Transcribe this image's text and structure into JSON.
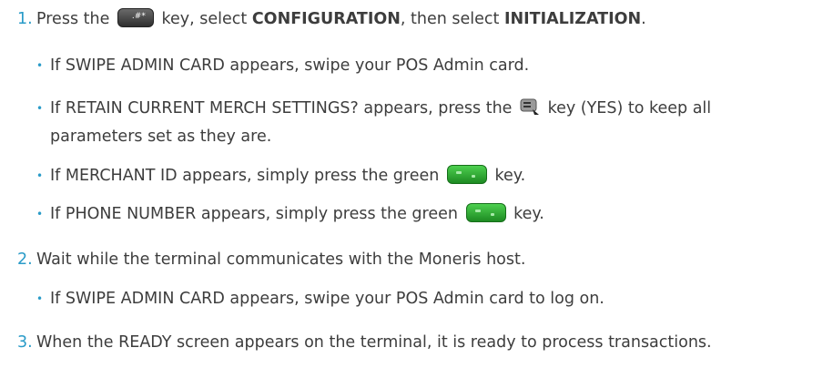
{
  "steps": [
    {
      "number": "1.",
      "parts": {
        "a": "Press the",
        "b": "key, select",
        "c": "CONFIGURATION",
        "d": ", then select",
        "e": "INITIALIZATION",
        "f": "."
      },
      "bullets": [
        {
          "text": "If SWIPE ADMIN CARD appears, swipe your POS Admin card."
        },
        {
          "a": "If RETAIN CURRENT MERCH SETTINGS? appears, press the",
          "b": "key (YES) to keep all",
          "c": "parameters set as they are."
        },
        {
          "a": "If MERCHANT ID appears, simply press the green",
          "b": "key."
        },
        {
          "a": "If PHONE NUMBER appears, simply press the green",
          "b": "key."
        }
      ]
    },
    {
      "number": "2.",
      "text": "Wait while the terminal communicates with the Moneris host.",
      "bullets": [
        {
          "text": "If SWIPE ADMIN CARD appears, swipe your POS Admin card to log on."
        }
      ]
    },
    {
      "number": "3.",
      "text": "When the READY screen appears on the terminal, it is ready to process transactions."
    }
  ],
  "bullet_symbol": "•",
  "icons": {
    "hash_key_label": ".#*",
    "hash_key": "hash-key-icon",
    "softkey": "softkey-icon",
    "green_key": "green-key-icon"
  },
  "colors": {
    "text": "#3d3d3d",
    "accent": "#2a9bc8",
    "green_key": "#2fb034"
  }
}
